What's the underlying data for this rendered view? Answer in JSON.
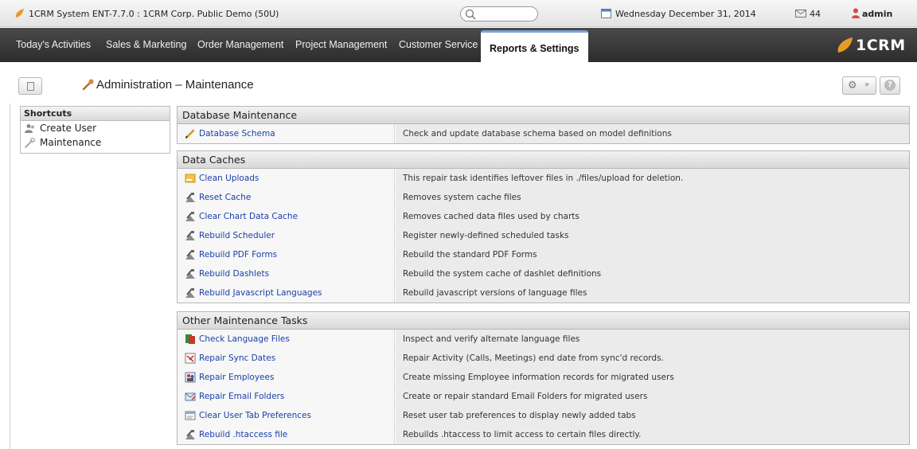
{
  "topbar": {
    "system_title": "1CRM System ENT-7.7.0 : 1CRM Corp. Public Demo (50U)",
    "date": "Wednesday December 31, 2014",
    "mail_count": "44",
    "user": "admin"
  },
  "nav": {
    "tabs": [
      {
        "label": "Today's Activities"
      },
      {
        "label": "Sales & Marketing"
      },
      {
        "label": "Order Management"
      },
      {
        "label": "Project Management"
      },
      {
        "label": "Customer Service"
      },
      {
        "label": "Reports & Settings",
        "active": true
      }
    ],
    "brand": "1CRM",
    "brand_colors": [
      "#e5a32b",
      "#76b54b",
      "#3f8fcd",
      "#8a5bc5",
      "#d04a7c"
    ]
  },
  "page": {
    "title": "Administration – Maintenance"
  },
  "shortcuts": {
    "heading": "Shortcuts",
    "items": [
      {
        "label": "Create User",
        "icon": "users-icon"
      },
      {
        "label": "Maintenance",
        "icon": "wrench-icon"
      }
    ]
  },
  "sections": [
    {
      "title": "Database Maintenance",
      "rows": [
        {
          "label": "Database Schema",
          "desc": "Check and update database schema based on model definitions",
          "icon": "pencil-icon"
        }
      ]
    },
    {
      "title": "Data Caches",
      "rows": [
        {
          "label": "Clean Uploads",
          "desc": "This repair task identifies leftover files in ./files/upload for deletion.",
          "icon": "folder-icon"
        },
        {
          "label": "Reset Cache",
          "desc": "Removes system cache files",
          "icon": "repair-icon"
        },
        {
          "label": "Clear Chart Data Cache",
          "desc": "Removes cached data files used by charts",
          "icon": "repair-icon"
        },
        {
          "label": "Rebuild Scheduler",
          "desc": "Register newly-defined scheduled tasks",
          "icon": "repair-icon"
        },
        {
          "label": "Rebuild PDF Forms",
          "desc": "Rebuild the standard PDF Forms",
          "icon": "repair-icon"
        },
        {
          "label": "Rebuild Dashlets",
          "desc": "Rebuild the system cache of dashlet definitions",
          "icon": "repair-icon"
        },
        {
          "label": "Rebuild Javascript Languages",
          "desc": "Rebuild javascript versions of language files",
          "icon": "repair-icon"
        }
      ]
    },
    {
      "title": "Other Maintenance Tasks",
      "rows": [
        {
          "label": "Check Language Files",
          "desc": "Inspect and verify alternate language files",
          "icon": "language-icon"
        },
        {
          "label": "Repair Sync Dates",
          "desc": "Repair Activity (Calls, Meetings) end date from sync'd records.",
          "icon": "sync-icon"
        },
        {
          "label": "Repair Employees",
          "desc": "Create missing Employee information records for migrated users",
          "icon": "employees-icon"
        },
        {
          "label": "Repair Email Folders",
          "desc": "Create or repair standard Email Folders for migrated users",
          "icon": "email-folder-icon"
        },
        {
          "label": "Clear User Tab Preferences",
          "desc": "Reset user tab preferences to display newly added tabs",
          "icon": "tab-prefs-icon"
        },
        {
          "label": "Rebuild .htaccess file",
          "desc": "Rebuilds .htaccess to limit access to certain files directly.",
          "icon": "repair-icon"
        }
      ]
    }
  ]
}
